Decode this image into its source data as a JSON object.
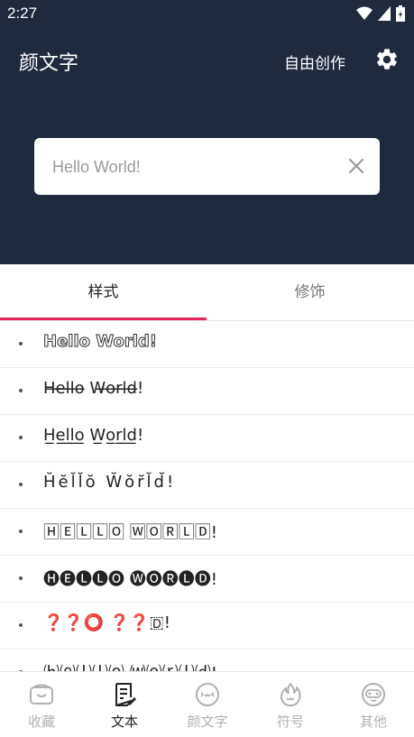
{
  "status_bar": {
    "time": "2:27"
  },
  "header": {
    "title": "颜文字",
    "free_create": "自由创作"
  },
  "search": {
    "placeholder": "Hello World!"
  },
  "tabs": [
    {
      "label": "样式"
    },
    {
      "label": "修饰"
    }
  ],
  "styles": [
    "Hello World!",
    "H̶e̶l̶l̶o̶ W̶o̶r̶l̶d̶!",
    "H̲e̲l̲l̲o̲ W̲o̲r̲l̲d̲!",
    "H̆ĕl̆l̆ŏ W̆ŏr̆l̆d̆!",
    "🄷🄴🄻🄻🄾 🅆🄾🅁🄻🄳!",
    "🅗🅔🅛🅛🅞 🅦🅞🅡🅛🅓!",
    "❓❓⭕ ❓❓🇩!",
    "⒣⒠⒧⒧⒪ ⒲⒪⒭⒧⒟!"
  ],
  "bottom_nav": [
    {
      "label": "收藏",
      "icon": "wallet-icon"
    },
    {
      "label": "文本",
      "icon": "document-edit-icon"
    },
    {
      "label": "颜文字",
      "icon": "emoticon-face-icon"
    },
    {
      "label": "符号",
      "icon": "fire-icon"
    },
    {
      "label": "其他",
      "icon": "robot-face-icon"
    }
  ],
  "colors": {
    "header_bg": "#1f2a3d",
    "accent": "#e5245e"
  }
}
